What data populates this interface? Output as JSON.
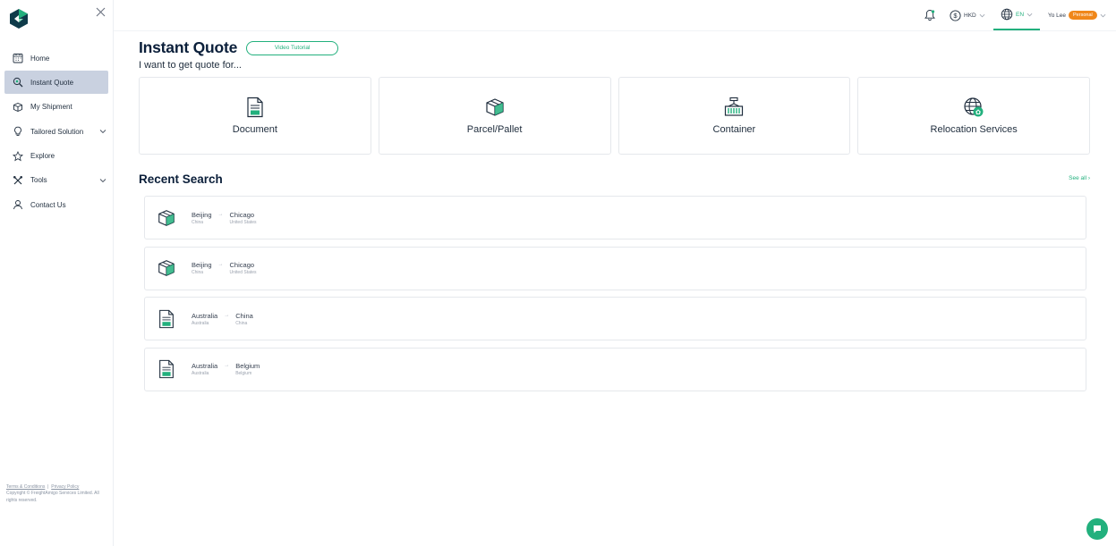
{
  "sidebar": {
    "items": [
      {
        "label": "Home",
        "icon": "calendar-icon"
      },
      {
        "label": "Instant Quote",
        "icon": "search-quote-icon",
        "active": true
      },
      {
        "label": "My Shipment",
        "icon": "box-icon"
      },
      {
        "label": "Tailored Solution",
        "icon": "lightbulb-icon",
        "expandable": true
      },
      {
        "label": "Explore",
        "icon": "star-icon"
      },
      {
        "label": "Tools",
        "icon": "tools-icon",
        "expandable": true
      },
      {
        "label": "Contact Us",
        "icon": "headset-icon"
      }
    ],
    "footer": {
      "terms": "Terms & Conditions",
      "separator": "|",
      "privacy": "Privacy Policy",
      "copyright": "Copyright © FreightAmigo Services Limited. All rights reserved."
    }
  },
  "topbar": {
    "currency": "HKD",
    "language": "EN",
    "user_name": "Yo Lee",
    "user_badge": "Personal"
  },
  "main": {
    "title": "Instant Quote",
    "video_button": "Video Tutorial",
    "subtitle": "I want to get quote for...",
    "cards": [
      {
        "label": "Document",
        "icon": "document-icon"
      },
      {
        "label": "Parcel/Pallet",
        "icon": "parcel-icon"
      },
      {
        "label": "Container",
        "icon": "container-icon"
      },
      {
        "label": "Relocation Services",
        "icon": "relocation-globe-icon"
      }
    ],
    "recent_title": "Recent Search",
    "see_all": "See all ›",
    "recent": [
      {
        "icon": "parcel-icon",
        "from_city": "Beijing",
        "from_country": "China",
        "to_city": "Chicago",
        "to_country": "United States"
      },
      {
        "icon": "parcel-icon",
        "from_city": "Beijing",
        "from_country": "China",
        "to_city": "Chicago",
        "to_country": "United States"
      },
      {
        "icon": "document-icon",
        "from_city": "Australia",
        "from_country": "Australia",
        "to_city": "China",
        "to_country": "China"
      },
      {
        "icon": "document-icon",
        "from_city": "Australia",
        "from_country": "Australia",
        "to_city": "Belgium",
        "to_country": "Belgium"
      }
    ]
  },
  "colors": {
    "accent": "#22b07d",
    "navy": "#0b1f3a",
    "active_bg": "#c9d1e0",
    "badge": "#f0871a"
  }
}
